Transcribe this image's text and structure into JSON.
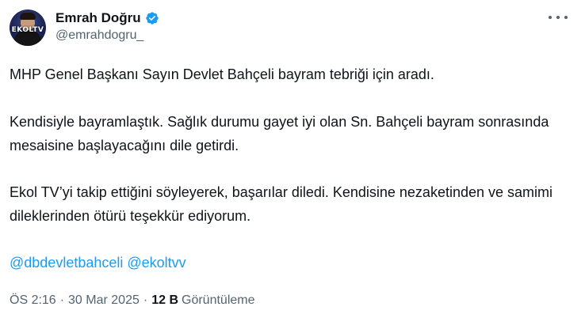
{
  "author": {
    "display_name": "Emrah Doğru",
    "handle": "@emrahdogru_",
    "verified": true,
    "avatar_logo_text": "EKOLTV"
  },
  "tweet": {
    "paragraph_1": "MHP Genel Başkanı Sayın Devlet Bahçeli bayram tebriği için aradı.",
    "paragraph_2": "Kendisiyle bayramlaştık. Sağlık durumu gayet iyi olan Sn. Bahçeli bayram sonrasında mesaisine başlayacağını dile getirdi.",
    "paragraph_3": "Ekol TV’yi takip ettiğini söyleyerek, başarılar diledi. Kendisine nezaketinden ve samimi dileklerinden ötürü teşekkür ediyorum.",
    "mentions": [
      "@dbdevletbahceli",
      "@ekoltvv"
    ]
  },
  "meta": {
    "time": "ÖS 2:16",
    "separator": "·",
    "date": "30 Mar 2025",
    "views_count": "12 B",
    "views_label": "Görüntüleme"
  },
  "colors": {
    "text": "#0f1419",
    "secondary": "#536471",
    "link": "#1d9bf0",
    "verified_badge": "#1d9bf0"
  },
  "icons": {
    "verified": "verified-badge-icon",
    "more": "more-options-icon"
  }
}
